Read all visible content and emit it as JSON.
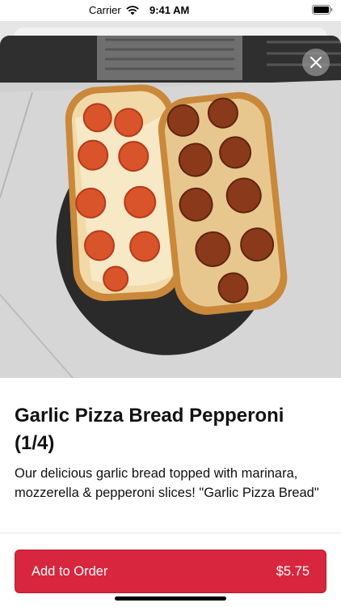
{
  "status_bar": {
    "carrier": "Carrier",
    "time": "9:41 AM"
  },
  "product": {
    "title": "Garlic Pizza Bread Pepperoni (1/4)",
    "description": "Our delicious garlic bread topped with marinara, mozzerella & pepperoni slices! \"Garlic Pizza Bread\"",
    "image_icon": "product-photo"
  },
  "actions": {
    "add_label": "Add to Order",
    "price": "$5.75"
  },
  "colors": {
    "accent": "#d7263d",
    "background": "#ffffff",
    "text": "#111111"
  }
}
